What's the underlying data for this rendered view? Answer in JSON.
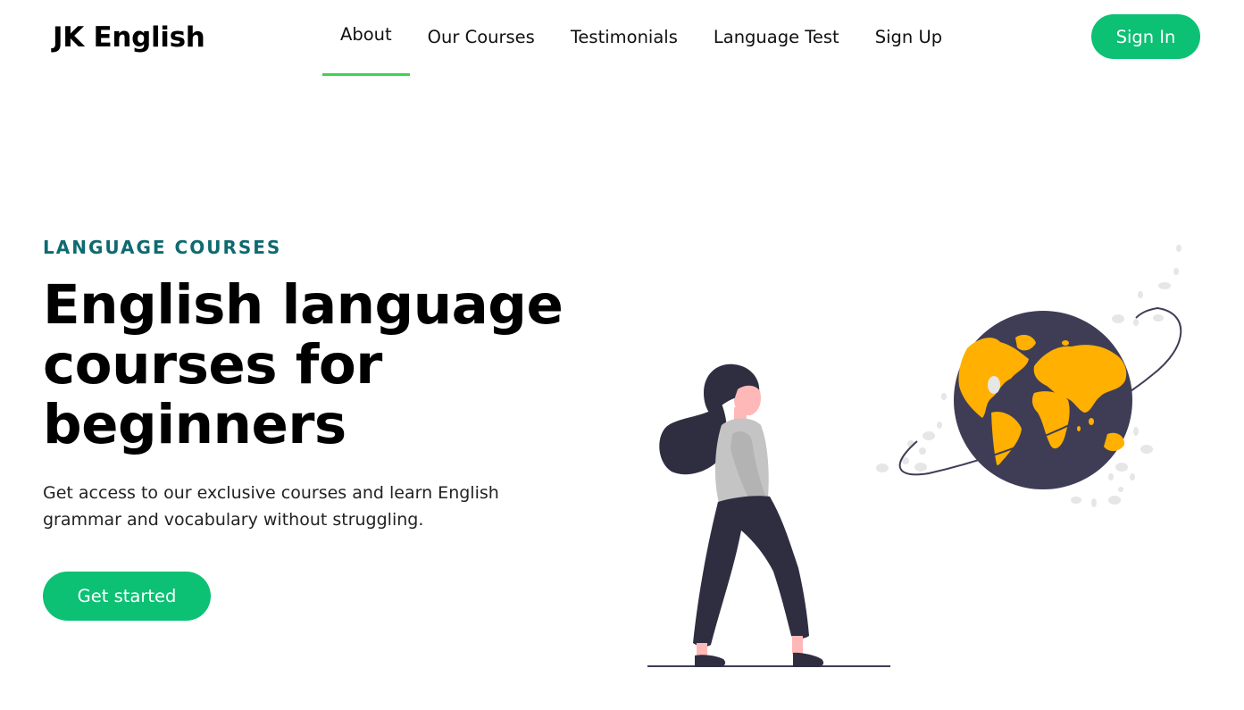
{
  "header": {
    "logo": "JK English",
    "nav": [
      {
        "label": "About",
        "active": true
      },
      {
        "label": "Our Courses",
        "active": false
      },
      {
        "label": "Testimonials",
        "active": false
      },
      {
        "label": "Language Test",
        "active": false
      },
      {
        "label": "Sign Up",
        "active": false
      }
    ],
    "signin_label": "Sign In"
  },
  "hero": {
    "eyebrow": "LANGUAGE COURSES",
    "headline": "English language courses for beginners",
    "subtext": "Get access to our exclusive courses and learn English grammar and vocabulary without struggling.",
    "cta_label": "Get started"
  },
  "colors": {
    "accent": "#0cc074",
    "active_underline": "#3dd351",
    "eyebrow": "#0e6a70",
    "globe": "#3f3d56",
    "continents": "#ffb000"
  },
  "illustration": {
    "icon": "woman-looking-at-globe-icon"
  }
}
